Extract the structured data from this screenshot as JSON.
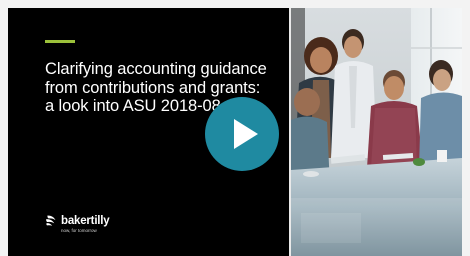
{
  "video": {
    "title_lines": [
      "Clarifying accounting guidance",
      "from contributions and grants:",
      "a look into ASU 2018-08"
    ],
    "brand": {
      "name": "bakertilly",
      "tagline": "now, for tomorrow"
    },
    "play_button_icon": "play-icon",
    "photo_description_icon": "meeting-photo"
  },
  "colors": {
    "accent": "#9cc13b",
    "play_button": "#1f8aa1",
    "panel": "#000000"
  }
}
